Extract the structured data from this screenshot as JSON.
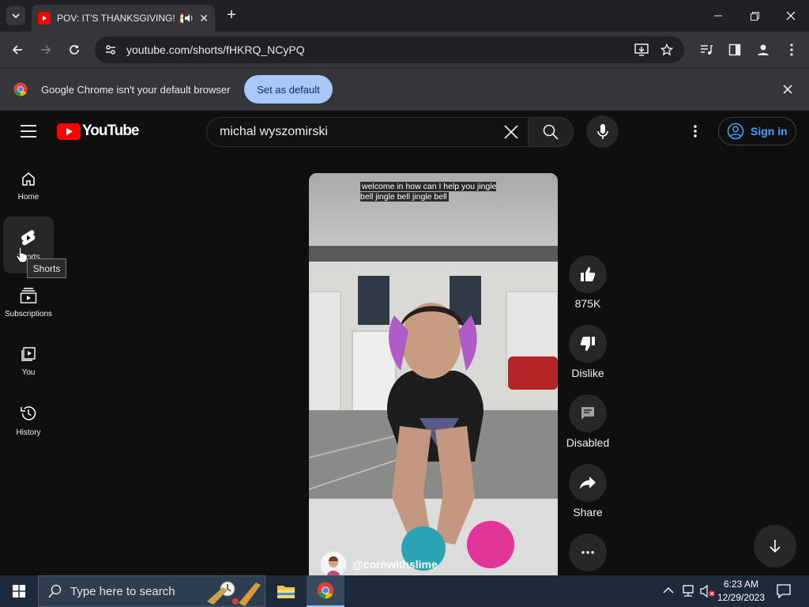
{
  "browser": {
    "tab_title": "POV: IT'S THANKSGIVING! 🎅",
    "url": "youtube.com/shorts/fHKRQ_NCyPQ",
    "infobar_text": "Google Chrome isn't your default browser",
    "set_default_label": "Set as default"
  },
  "youtube": {
    "logo_text": "YouTube",
    "search_value": "michal wyszomirski",
    "sign_in_label": "Sign in",
    "sidebar": [
      {
        "label": "Home",
        "icon": "home-icon"
      },
      {
        "label": "Shorts",
        "icon": "shorts-icon"
      },
      {
        "label": "Subscriptions",
        "icon": "subscriptions-icon"
      },
      {
        "label": "You",
        "icon": "you-icon"
      },
      {
        "label": "History",
        "icon": "history-icon"
      }
    ],
    "tooltip": "Shorts"
  },
  "short": {
    "caption": "welcome in how can I help you jingle bell jingle bell jingle bell",
    "channel": "@cornwithslime",
    "actions": {
      "like_count": "875K",
      "dislike_label": "Dislike",
      "comments_label": "Disabled",
      "share_label": "Share"
    }
  },
  "taskbar": {
    "search_placeholder": "Type here to search",
    "time": "6:23 AM",
    "date": "12/29/2023"
  },
  "colors": {
    "youtube_red": "#ff0000",
    "link_blue": "#3ea6ff",
    "chrome_button": "#a8c7fa"
  }
}
